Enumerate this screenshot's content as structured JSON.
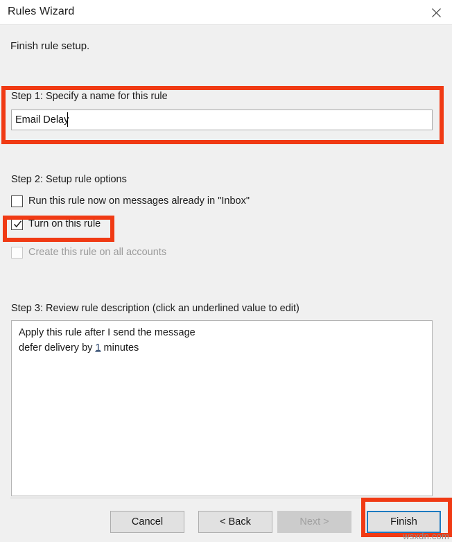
{
  "window": {
    "title": "Rules Wizard",
    "close_icon": "close-icon"
  },
  "header": {
    "text": "Finish rule setup."
  },
  "step1": {
    "label": "Step 1: Specify a name for this rule",
    "input_value": "Email Delay",
    "input_placeholder": ""
  },
  "step2": {
    "label": "Step 2: Setup rule options",
    "options": [
      {
        "label": "Run this rule now on messages already in \"Inbox\"",
        "checked": false,
        "disabled": false
      },
      {
        "label": "Turn on this rule",
        "checked": true,
        "disabled": false
      },
      {
        "label": "Create this rule on all accounts",
        "checked": false,
        "disabled": true
      }
    ]
  },
  "step3": {
    "label": "Step 3: Review rule description (click an underlined value to edit)",
    "description_line1": "Apply this rule after I send the message",
    "description_line2_prefix": "defer delivery by ",
    "description_link": "1",
    "description_line2_suffix": " minutes"
  },
  "buttons": {
    "cancel": "Cancel",
    "back": "< Back",
    "next": "Next >",
    "finish": "Finish"
  },
  "watermark": "wsxdn.com",
  "colors": {
    "annotation_red": "#f03a14",
    "focus_blue": "#1c7ac0",
    "link_blue": "#1f3b63",
    "dialog_bg": "#f0f0f0",
    "button_bg": "#e1e1e1",
    "button_disabled_bg": "#cccccc"
  }
}
